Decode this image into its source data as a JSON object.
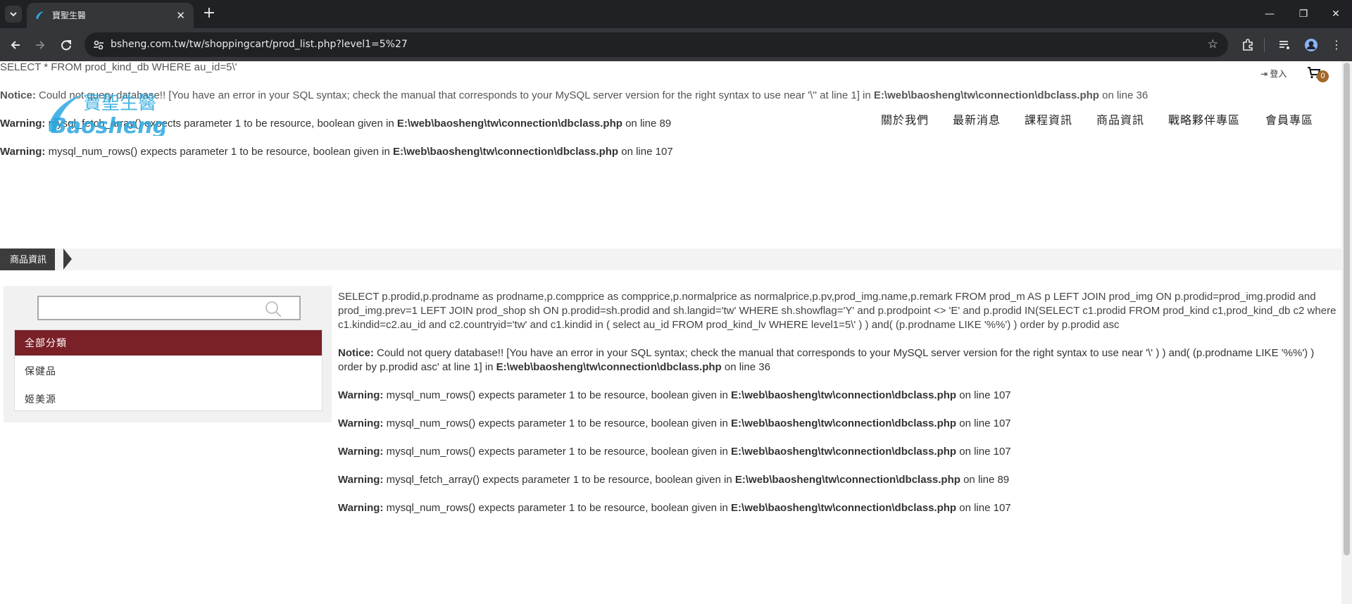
{
  "browser": {
    "tab_title": "寶聖生醫",
    "url": "bsheng.com.tw/tw/shoppingcart/prod_list.php?level1=5%27"
  },
  "errors_top": {
    "sql": "SELECT * FROM prod_kind_db WHERE au_id=5\\'",
    "notice_label": "Notice:",
    "notice_text": " Could not query database!! [You have an error in your SQL syntax; check the manual that corresponds to your MySQL server version for the right syntax to use near '\\'' at line 1] in ",
    "notice_path": "E:\\web\\baosheng\\tw\\connection\\dbclass.php",
    "notice_line": " on line 36",
    "warn1_label": "Warning:",
    "warn1_text": " mysql_fetch_array() expects parameter 1 to be resource, boolean given in ",
    "warn1_path": "E:\\web\\baosheng\\tw\\connection\\dbclass.php",
    "warn1_line": " on line 89",
    "warn2_label": "Warning:",
    "warn2_text": " mysql_num_rows() expects parameter 1 to be resource, boolean given in ",
    "warn2_path": "E:\\web\\baosheng\\tw\\connection\\dbclass.php",
    "warn2_line": " on line 107"
  },
  "header": {
    "logo_cn": "寶聖生醫",
    "logo_en": "Baosheng",
    "login": "登入",
    "cart_count": "0",
    "nav": [
      "關於我們",
      "最新消息",
      "課程資訊",
      "商品資訊",
      "戰略夥伴專區",
      "會員專區"
    ]
  },
  "section": {
    "title": "商品資訊"
  },
  "sidebar": {
    "search_placeholder": "",
    "all_label": "全部分類",
    "categories": [
      "保健品",
      "姬美源"
    ]
  },
  "content": {
    "sql": "SELECT p.prodid,p.prodname as prodname,p.compprice as compprice,p.normalprice as normalprice,p.pv,prod_img.name,p.remark FROM prod_m AS p LEFT JOIN prod_img ON p.prodid=prod_img.prodid and prod_img.prev=1 LEFT JOIN prod_shop sh ON p.prodid=sh.prodid and sh.langid='tw' WHERE sh.showflag='Y' and p.prodpoint <> 'E' and p.prodid IN(SELECT c1.prodid FROM prod_kind c1,prod_kind_db c2 where c1.kindid=c2.au_id and c2.countryid='tw' and c1.kindid in ( select au_id FROM prod_kind_lv WHERE level1=5\\' ) ) and( (p.prodname LIKE '%%') ) order by p.prodid asc",
    "notice_label": "Notice:",
    "notice_text": " Could not query database!! [You have an error in your SQL syntax; check the manual that corresponds to your MySQL server version for the right syntax to use near '\\' ) ) and( (p.prodname LIKE '%%') ) order by p.prodid asc' at line 1] in ",
    "notice_path": "E:\\web\\baosheng\\tw\\connection\\dbclass.php",
    "notice_line": " on line 36",
    "warnings": [
      {
        "label": "Warning:",
        "text": " mysql_num_rows() expects parameter 1 to be resource, boolean given in ",
        "path": "E:\\web\\baosheng\\tw\\connection\\dbclass.php",
        "line": " on line 107"
      },
      {
        "label": "Warning:",
        "text": " mysql_num_rows() expects parameter 1 to be resource, boolean given in ",
        "path": "E:\\web\\baosheng\\tw\\connection\\dbclass.php",
        "line": " on line 107"
      },
      {
        "label": "Warning:",
        "text": " mysql_num_rows() expects parameter 1 to be resource, boolean given in ",
        "path": "E:\\web\\baosheng\\tw\\connection\\dbclass.php",
        "line": " on line 107"
      },
      {
        "label": "Warning:",
        "text": " mysql_fetch_array() expects parameter 1 to be resource, boolean given in ",
        "path": "E:\\web\\baosheng\\tw\\connection\\dbclass.php",
        "line": " on line 89"
      },
      {
        "label": "Warning:",
        "text": " mysql_num_rows() expects parameter 1 to be resource, boolean given in ",
        "path": "E:\\web\\baosheng\\tw\\connection\\dbclass.php",
        "line": " on line 107"
      }
    ]
  },
  "colors": {
    "accent_category": "#7a2027",
    "logo_blue": "#2aa8e0",
    "cart_badge": "#a2682c"
  }
}
